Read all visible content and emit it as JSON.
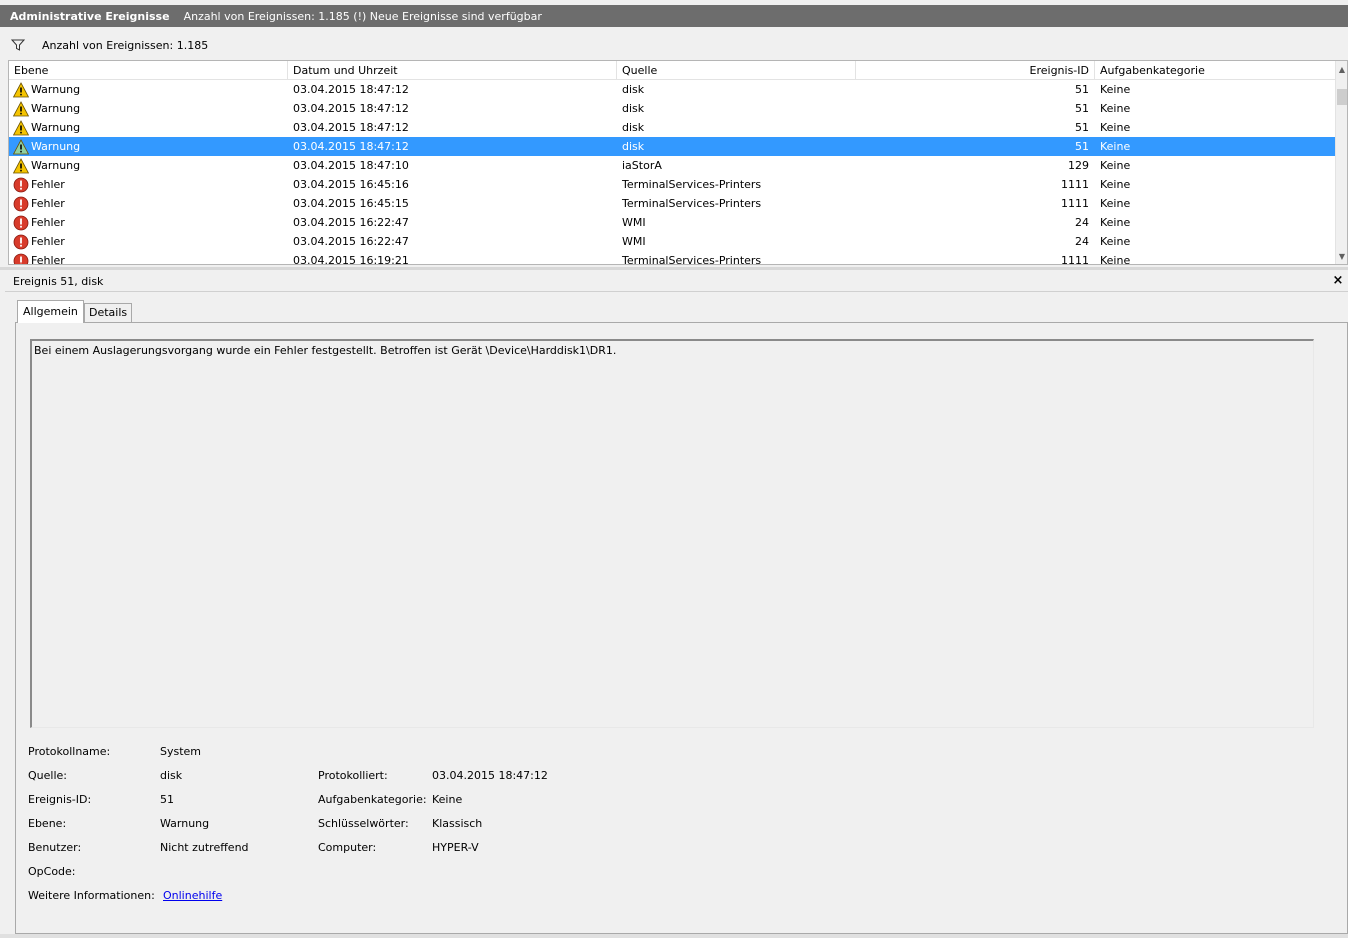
{
  "titlebar": {
    "title": "Administrative Ereignisse",
    "status": "Anzahl von Ereignissen: 1.185 (!) Neue Ereignisse sind verfügbar"
  },
  "filterbar": {
    "text": "Anzahl von Ereignissen: 1.185",
    "icon": "filter-icon"
  },
  "grid": {
    "columns": [
      "Ebene",
      "Datum und Uhrzeit",
      "Quelle",
      "Ereignis-ID",
      "Aufgabenkategorie"
    ],
    "rows": [
      {
        "level": "Warnung",
        "type": "warning",
        "date": "03.04.2015 18:47:12",
        "source": "disk",
        "id": "51",
        "category": "Keine"
      },
      {
        "level": "Warnung",
        "type": "warning",
        "date": "03.04.2015 18:47:12",
        "source": "disk",
        "id": "51",
        "category": "Keine"
      },
      {
        "level": "Warnung",
        "type": "warning",
        "date": "03.04.2015 18:47:12",
        "source": "disk",
        "id": "51",
        "category": "Keine"
      },
      {
        "level": "Warnung",
        "type": "warning",
        "date": "03.04.2015 18:47:12",
        "source": "disk",
        "id": "51",
        "category": "Keine",
        "selected": true
      },
      {
        "level": "Warnung",
        "type": "warning",
        "date": "03.04.2015 18:47:10",
        "source": "iaStorA",
        "id": "129",
        "category": "Keine"
      },
      {
        "level": "Fehler",
        "type": "error",
        "date": "03.04.2015 16:45:16",
        "source": "TerminalServices-Printers",
        "id": "1111",
        "category": "Keine"
      },
      {
        "level": "Fehler",
        "type": "error",
        "date": "03.04.2015 16:45:15",
        "source": "TerminalServices-Printers",
        "id": "1111",
        "category": "Keine"
      },
      {
        "level": "Fehler",
        "type": "error",
        "date": "03.04.2015 16:22:47",
        "source": "WMI",
        "id": "24",
        "category": "Keine"
      },
      {
        "level": "Fehler",
        "type": "error",
        "date": "03.04.2015 16:22:47",
        "source": "WMI",
        "id": "24",
        "category": "Keine"
      },
      {
        "level": "Fehler",
        "type": "error",
        "date": "03.04.2015 16:19:21",
        "source": "TerminalServices-Printers",
        "id": "1111",
        "category": "Keine"
      }
    ]
  },
  "detail": {
    "header": "Ereignis 51, disk",
    "close": "×",
    "tabs": [
      "Allgemein",
      "Details"
    ],
    "description": "Bei einem Auslagerungsvorgang wurde ein Fehler festgestellt. Betroffen ist Gerät \\Device\\Harddisk1\\DR1.",
    "props": {
      "logname_label": "Protokollname:",
      "logname": "System",
      "source_label": "Quelle:",
      "source": "disk",
      "logged_label": "Protokolliert:",
      "logged": "03.04.2015 18:47:12",
      "eventid_label": "Ereignis-ID:",
      "eventid": "51",
      "taskcat_label": "Aufgabenkategorie:",
      "taskcat": "Keine",
      "level_label": "Ebene:",
      "level": "Warnung",
      "keywords_label": "Schlüsselwörter:",
      "keywords": "Klassisch",
      "user_label": "Benutzer:",
      "user": "Nicht zutreffend",
      "computer_label": "Computer:",
      "computer": "HYPER-V",
      "opcode_label": "OpCode:",
      "moreinfo_label": "Weitere Informationen:",
      "moreinfo_link": "Onlinehilfe"
    }
  },
  "colors": {
    "titlebar_bg": "#6d6d6d",
    "selection": "#3399ff",
    "warning": "#f5c400",
    "error": "#d83b2b",
    "link": "#0000ee"
  }
}
